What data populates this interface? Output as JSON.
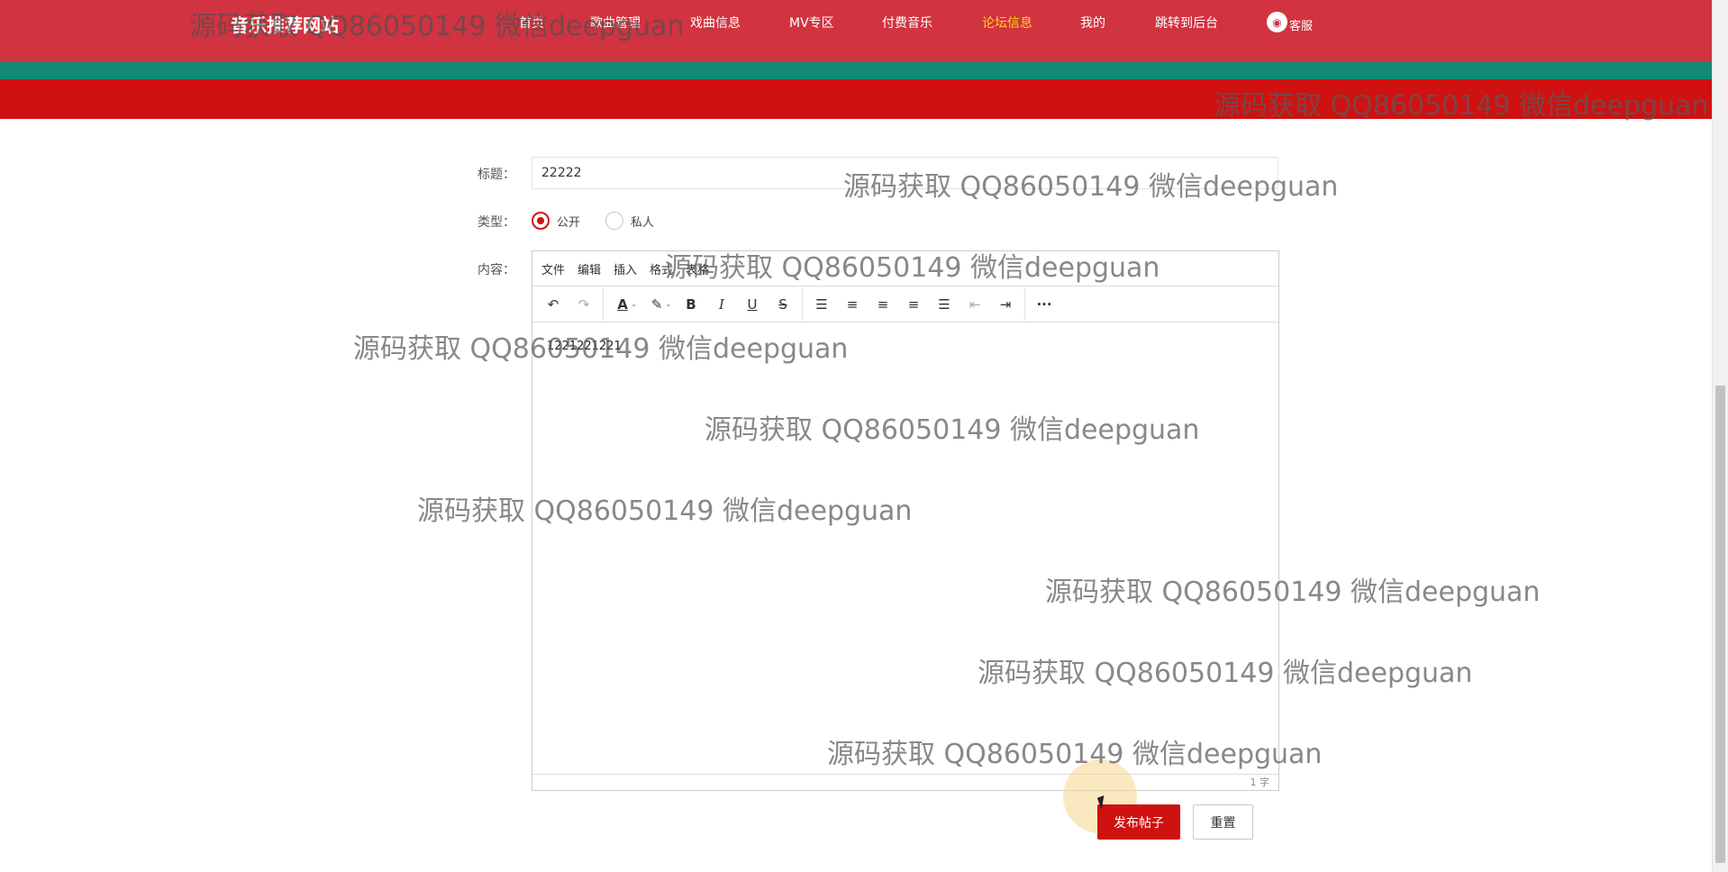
{
  "header": {
    "site_title": "音乐推荐网站",
    "nav": [
      {
        "label": "首页",
        "active": false
      },
      {
        "label": "歌曲管理",
        "active": false
      },
      {
        "label": "戏曲信息",
        "active": false
      },
      {
        "label": "MV专区",
        "active": false
      },
      {
        "label": "付费音乐",
        "active": false
      },
      {
        "label": "论坛信息",
        "active": true
      },
      {
        "label": "我的",
        "active": false
      },
      {
        "label": "跳转到后台",
        "active": false
      },
      {
        "label": "客服",
        "active": false
      }
    ],
    "colors": {
      "nav_bg": "#d13340",
      "active_text": "#ffd21a",
      "strip": "#138a76",
      "banner": "#cf1111"
    }
  },
  "form": {
    "title_label": "标题：",
    "title_value": "22222",
    "type_label": "类型：",
    "type_options": [
      {
        "label": "公开",
        "checked": true
      },
      {
        "label": "私人",
        "checked": false
      }
    ],
    "content_label": "内容："
  },
  "editor": {
    "menus": [
      "文件",
      "编辑",
      "插入",
      "格式",
      "表格"
    ],
    "toolbar_icons": [
      "undo-icon",
      "redo-icon",
      "text-color-icon",
      "highlight-color-icon",
      "bold-icon",
      "italic-icon",
      "underline-icon",
      "strikethrough-icon",
      "line-height-icon",
      "align-left-icon",
      "align-center-icon",
      "align-right-icon",
      "align-justify-icon",
      "outdent-icon",
      "indent-icon",
      "more-icon"
    ],
    "content": "1221221221",
    "word_count": "1 字"
  },
  "buttons": {
    "submit": "发布帖子",
    "reset": "重置"
  },
  "watermark": "源码获取 QQ86050149 微信deepguan"
}
